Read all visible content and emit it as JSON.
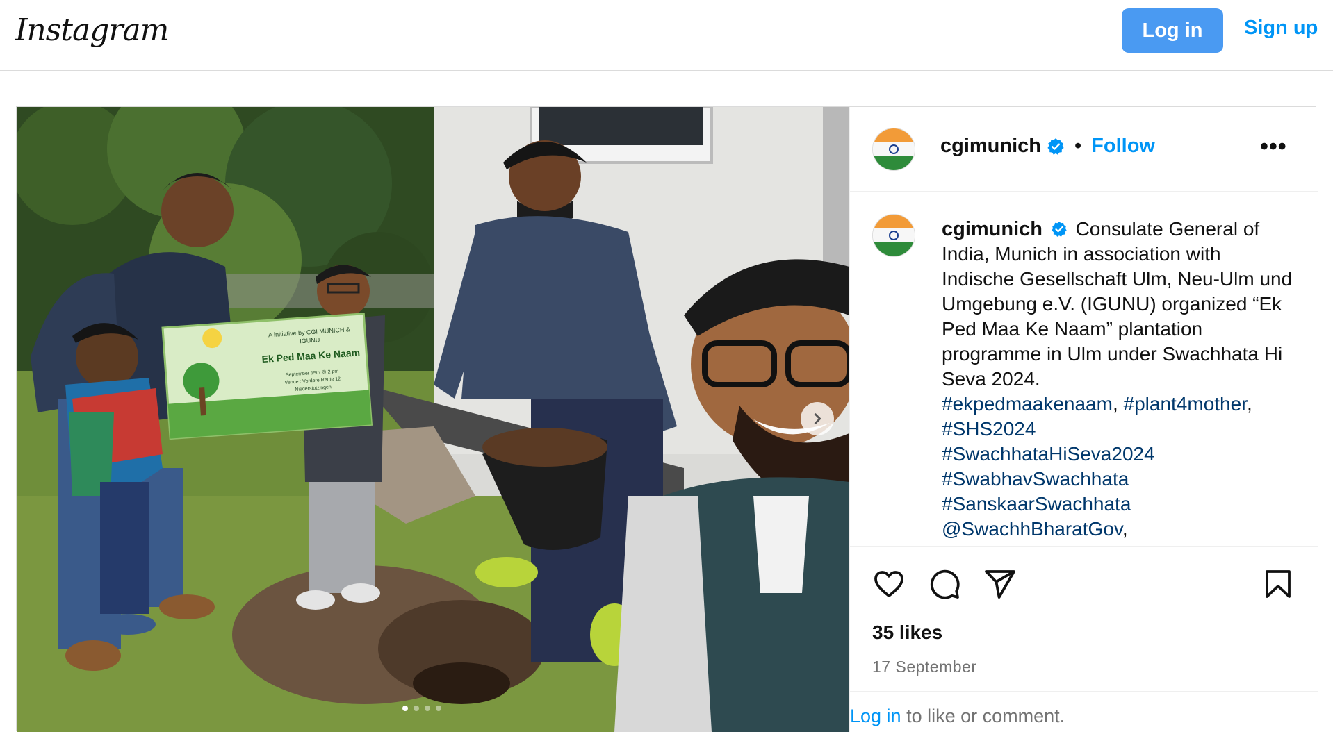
{
  "header": {
    "logo": "Instagram",
    "login_label": "Log in",
    "signup_label": "Sign up"
  },
  "post": {
    "username": "cgimunich",
    "follow_label": "Follow",
    "separator": "•",
    "more_label": "•••",
    "caption": {
      "username": "cgimunich",
      "text": "Consulate General of India, Munich in association with Indische Gesellschaft Ulm, Neu-Ulm und Umgebung e.V. (IGUNU) organized “Ek Ped Maa Ke Naam” plantation programme in Ulm under Swachhata Hi Seva 2024.",
      "tags": [
        "#ekpedmaakenaam",
        "#plant4mother",
        "#SHS2024",
        "#SwachhataHiSeva2024",
        "#SwabhavSwachhata",
        "#SanskaarSwachhata",
        "@SwachhBharatGov"
      ]
    },
    "banner": {
      "line1": "A initiative by CGI MUNICH &",
      "line2": "IGUNU",
      "title": "Ek Ped Maa Ke Naam",
      "line3": "September 15th @ 2 pm",
      "line4": "Venue : Vordere Reute 12",
      "line5": "Niederstotzingen"
    },
    "likes": "35 likes",
    "date": "17 September",
    "login_prompt": {
      "link": "Log in",
      "rest": " to like or comment."
    },
    "carousel": {
      "count": 4,
      "active": 0
    }
  },
  "colors": {
    "primary_button": "#4a9af2",
    "link_blue": "#0095f6",
    "hashtag": "#00376b",
    "verified": "#0095f6"
  },
  "icons": [
    "heart-icon",
    "comment-icon",
    "share-icon",
    "bookmark-icon",
    "verified-badge-icon",
    "chevron-right-icon",
    "more-icon"
  ]
}
